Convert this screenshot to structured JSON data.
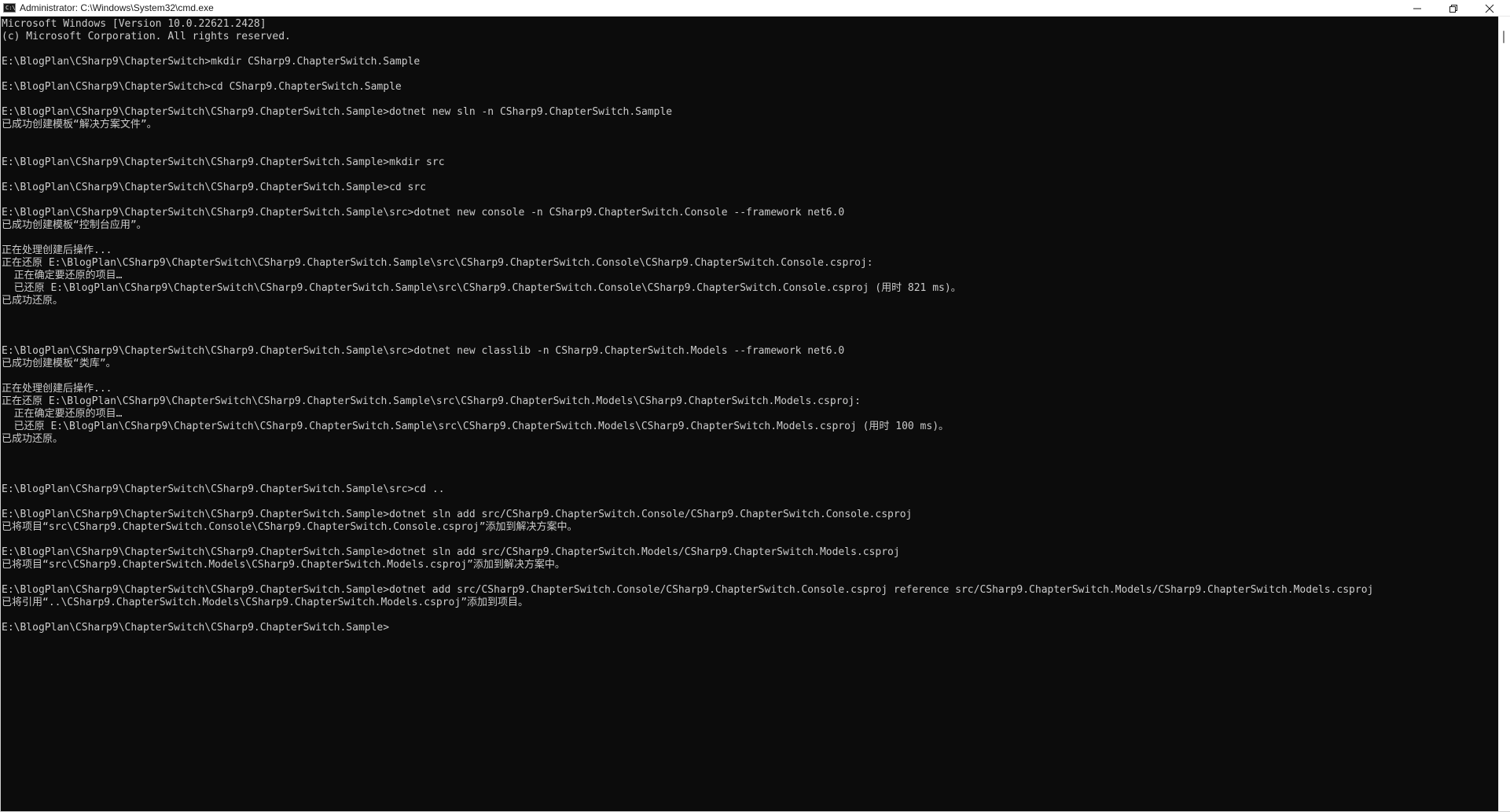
{
  "window": {
    "title": "Administrator: C:\\Windows\\System32\\cmd.exe",
    "icon": "cmd-icon",
    "icon_glyph": "C:\\",
    "controls": {
      "minimize_icon": "minimize-icon",
      "restore_icon": "restore-icon",
      "close_icon": "close-icon"
    }
  },
  "console": {
    "background": "#0c0c0c",
    "foreground": "#cccccc",
    "lines": [
      "Microsoft Windows [Version 10.0.22621.2428]",
      "(c) Microsoft Corporation. All rights reserved.",
      "",
      "E:\\BlogPlan\\CSharp9\\ChapterSwitch>mkdir CSharp9.ChapterSwitch.Sample",
      "",
      "E:\\BlogPlan\\CSharp9\\ChapterSwitch>cd CSharp9.ChapterSwitch.Sample",
      "",
      "E:\\BlogPlan\\CSharp9\\ChapterSwitch\\CSharp9.ChapterSwitch.Sample>dotnet new sln -n CSharp9.ChapterSwitch.Sample",
      "已成功创建模板“解决方案文件”。",
      "",
      "",
      "E:\\BlogPlan\\CSharp9\\ChapterSwitch\\CSharp9.ChapterSwitch.Sample>mkdir src",
      "",
      "E:\\BlogPlan\\CSharp9\\ChapterSwitch\\CSharp9.ChapterSwitch.Sample>cd src",
      "",
      "E:\\BlogPlan\\CSharp9\\ChapterSwitch\\CSharp9.ChapterSwitch.Sample\\src>dotnet new console -n CSharp9.ChapterSwitch.Console --framework net6.0",
      "已成功创建模板“控制台应用”。",
      "",
      "正在处理创建后操作...",
      "正在还原 E:\\BlogPlan\\CSharp9\\ChapterSwitch\\CSharp9.ChapterSwitch.Sample\\src\\CSharp9.ChapterSwitch.Console\\CSharp9.ChapterSwitch.Console.csproj:",
      "  正在确定要还原的项目…",
      "  已还原 E:\\BlogPlan\\CSharp9\\ChapterSwitch\\CSharp9.ChapterSwitch.Sample\\src\\CSharp9.ChapterSwitch.Console\\CSharp9.ChapterSwitch.Console.csproj (用时 821 ms)。",
      "已成功还原。",
      "",
      "",
      "",
      "E:\\BlogPlan\\CSharp9\\ChapterSwitch\\CSharp9.ChapterSwitch.Sample\\src>dotnet new classlib -n CSharp9.ChapterSwitch.Models --framework net6.0",
      "已成功创建模板“类库”。",
      "",
      "正在处理创建后操作...",
      "正在还原 E:\\BlogPlan\\CSharp9\\ChapterSwitch\\CSharp9.ChapterSwitch.Sample\\src\\CSharp9.ChapterSwitch.Models\\CSharp9.ChapterSwitch.Models.csproj:",
      "  正在确定要还原的项目…",
      "  已还原 E:\\BlogPlan\\CSharp9\\ChapterSwitch\\CSharp9.ChapterSwitch.Sample\\src\\CSharp9.ChapterSwitch.Models\\CSharp9.ChapterSwitch.Models.csproj (用时 100 ms)。",
      "已成功还原。",
      "",
      "",
      "",
      "E:\\BlogPlan\\CSharp9\\ChapterSwitch\\CSharp9.ChapterSwitch.Sample\\src>cd ..",
      "",
      "E:\\BlogPlan\\CSharp9\\ChapterSwitch\\CSharp9.ChapterSwitch.Sample>dotnet sln add src/CSharp9.ChapterSwitch.Console/CSharp9.ChapterSwitch.Console.csproj",
      "已将项目“src\\CSharp9.ChapterSwitch.Console\\CSharp9.ChapterSwitch.Console.csproj”添加到解决方案中。",
      "",
      "E:\\BlogPlan\\CSharp9\\ChapterSwitch\\CSharp9.ChapterSwitch.Sample>dotnet sln add src/CSharp9.ChapterSwitch.Models/CSharp9.ChapterSwitch.Models.csproj",
      "已将项目“src\\CSharp9.ChapterSwitch.Models\\CSharp9.ChapterSwitch.Models.csproj”添加到解决方案中。",
      "",
      "E:\\BlogPlan\\CSharp9\\ChapterSwitch\\CSharp9.ChapterSwitch.Sample>dotnet add src/CSharp9.ChapterSwitch.Console/CSharp9.ChapterSwitch.Console.csproj reference src/CSharp9.ChapterSwitch.Models/CSharp9.ChapterSwitch.Models.csproj",
      "已将引用“..\\CSharp9.ChapterSwitch.Models\\CSharp9.ChapterSwitch.Models.csproj”添加到项目。",
      "",
      "E:\\BlogPlan\\CSharp9\\ChapterSwitch\\CSharp9.ChapterSwitch.Sample>"
    ]
  }
}
